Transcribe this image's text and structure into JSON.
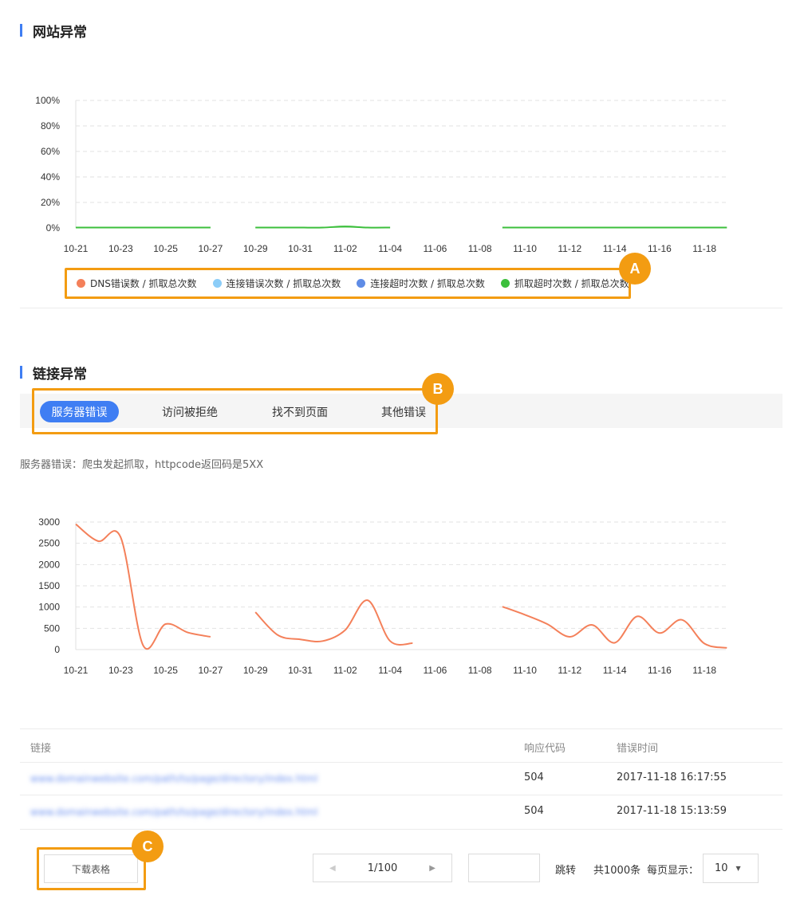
{
  "section1": {
    "title": "网站异常"
  },
  "chart1": {
    "type": "area",
    "x_labels": [
      "10-21",
      "10-23",
      "10-25",
      "10-27",
      "10-29",
      "10-31",
      "11-02",
      "11-04",
      "11-06",
      "11-08",
      "11-10",
      "11-12",
      "11-14",
      "11-16",
      "11-18"
    ],
    "y_ticks": [
      "100%",
      "80%",
      "60%",
      "40%",
      "20%",
      "0%"
    ],
    "legend": [
      {
        "label": "DNS错误数 / 抓取总次数",
        "color": "#f4805a"
      },
      {
        "label": "连接错误次数 / 抓取总次数",
        "color": "#8ccdf8"
      },
      {
        "label": "连接超时次数 / 抓取总次数",
        "color": "#5f8ce6"
      },
      {
        "label": "抓取超时次数 / 抓取总次数",
        "color": "#3cbf3c"
      }
    ]
  },
  "chart_data": [
    {
      "type": "area",
      "title": "",
      "ylim": [
        0,
        100
      ],
      "y_unit": "%",
      "x": [
        "10-21",
        "10-22",
        "10-23",
        "10-24",
        "10-25",
        "10-26",
        "10-27",
        "10-28",
        "10-29",
        "10-30",
        "10-31",
        "11-01",
        "11-02",
        "11-03",
        "11-04",
        "11-05",
        "11-06",
        "11-07",
        "11-08",
        "11-09",
        "11-10",
        "11-11",
        "11-12",
        "11-13",
        "11-14",
        "11-15",
        "11-16",
        "11-17",
        "11-18",
        "11-19"
      ],
      "series": [
        {
          "name": "抓取超时次数 / 抓取总次数",
          "color": "#3cbf3c",
          "values": [
            0.3,
            0.3,
            0.3,
            0.3,
            0.3,
            0.3,
            0.3,
            null,
            0.3,
            0.3,
            0.3,
            0.3,
            1.2,
            0.3,
            0.3,
            null,
            null,
            null,
            null,
            0.3,
            0.3,
            0.3,
            0.3,
            0.3,
            0.3,
            0.3,
            0.3,
            0.3,
            0.3,
            0.3
          ]
        }
      ],
      "grid": true,
      "legend_position": "bottom"
    },
    {
      "type": "line",
      "title": "",
      "ylim": [
        0,
        3000
      ],
      "y_ticks": [
        0,
        500,
        1000,
        1500,
        2000,
        2500,
        3000
      ],
      "x": [
        "10-21",
        "10-22",
        "10-23",
        "10-24",
        "10-25",
        "10-26",
        "10-27",
        "10-28",
        "10-29",
        "10-30",
        "10-31",
        "11-01",
        "11-02",
        "11-03",
        "11-04",
        "11-05",
        "11-06",
        "11-07",
        "11-08",
        "11-09",
        "11-10",
        "11-11",
        "11-12",
        "11-13",
        "11-14",
        "11-15",
        "11-16",
        "11-17",
        "11-18",
        "11-19"
      ],
      "series": [
        {
          "color": "#f4805a",
          "values": [
            2950,
            2550,
            2640,
            100,
            600,
            400,
            300,
            null,
            880,
            340,
            240,
            200,
            460,
            1160,
            200,
            150,
            null,
            null,
            null,
            1010,
            820,
            600,
            300,
            580,
            160,
            780,
            390,
            700,
            140,
            40
          ]
        }
      ],
      "grid": true
    }
  ],
  "section2": {
    "title": "链接异常"
  },
  "tabs": [
    {
      "label": "服务器错误",
      "active": true
    },
    {
      "label": "访问被拒绝",
      "active": false
    },
    {
      "label": "找不到页面",
      "active": false
    },
    {
      "label": "其他错误",
      "active": false
    }
  ],
  "tab_desc": "服务器错误：爬虫发起抓取，httpcode返回码是5XX",
  "chart2": {
    "x_labels": [
      "10-21",
      "10-23",
      "10-25",
      "10-27",
      "10-29",
      "10-31",
      "11-02",
      "11-04",
      "11-06",
      "11-08",
      "11-10",
      "11-12",
      "11-14",
      "11-16",
      "11-18"
    ],
    "y_ticks": [
      "3000",
      "2500",
      "2000",
      "1500",
      "1000",
      "500",
      "0"
    ]
  },
  "table": {
    "headers": {
      "link": "链接",
      "code": "响应代码",
      "time": "错误时间"
    },
    "rows": [
      {
        "link": "www.domainwebsite.com/path/to/page/directory/index.html",
        "code": "504",
        "time": "2017-11-18 16:17:55"
      },
      {
        "link": "www.domainwebsite.com/path/to/page/directory/index.html",
        "code": "504",
        "time": "2017-11-18 15:13:59"
      }
    ]
  },
  "download_label": "下载表格",
  "pagination": {
    "page": "1/100",
    "prev_icon": "◀",
    "next_icon": "▶",
    "jump_label": "跳转",
    "total": "共1000条",
    "per_page_label": "每页显示：",
    "per_page_value": "10",
    "caret": "▼"
  },
  "annotations": {
    "a": "A",
    "b": "B",
    "c": "C"
  },
  "colors": {
    "accent": "#3f7ef3",
    "annotation": "#f39c12",
    "line": "#f4805a"
  }
}
